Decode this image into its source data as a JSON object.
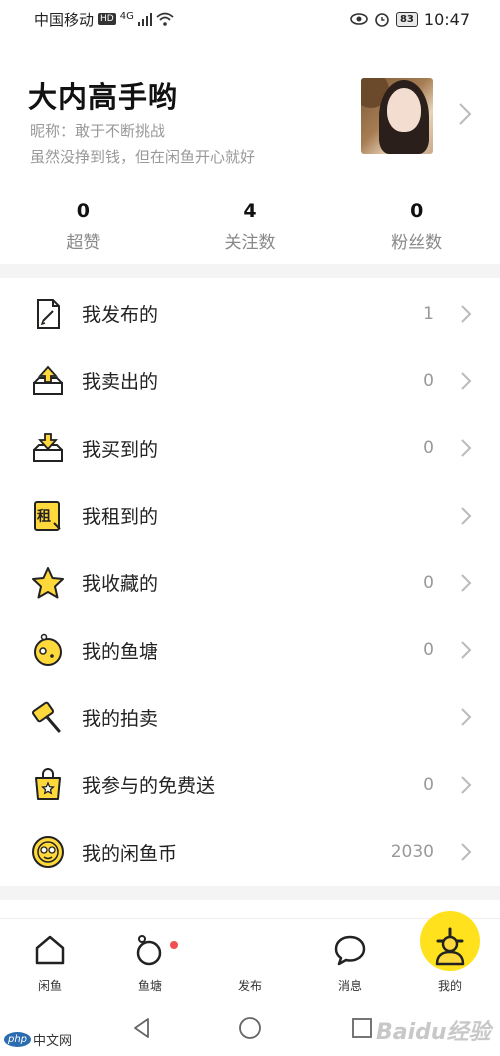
{
  "status_bar": {
    "carrier": "中国移动",
    "hd": "HD",
    "network": "4G",
    "battery": "83",
    "time": "10:47"
  },
  "profile": {
    "username": "大内高手哟",
    "nickname": "昵称：敢于不断挑战",
    "bio": "虽然没挣到钱，但在闲鱼开心就好"
  },
  "stats": [
    {
      "value": "0",
      "label": "超赞"
    },
    {
      "value": "4",
      "label": "关注数"
    },
    {
      "value": "0",
      "label": "粉丝数"
    }
  ],
  "menu": [
    {
      "label": "我发布的",
      "count": "1",
      "icon": "document-edit-icon"
    },
    {
      "label": "我卖出的",
      "count": "0",
      "icon": "box-upload-icon"
    },
    {
      "label": "我买到的",
      "count": "0",
      "icon": "box-download-icon"
    },
    {
      "label": "我租到的",
      "count": "",
      "icon": "rent-icon",
      "icon_text": "租"
    },
    {
      "label": "我收藏的",
      "count": "0",
      "icon": "star-icon"
    },
    {
      "label": "我的鱼塘",
      "count": "0",
      "icon": "fishpond-icon"
    },
    {
      "label": "我的拍卖",
      "count": "",
      "icon": "auction-hammer-icon"
    },
    {
      "label": "我参与的免费送",
      "count": "0",
      "icon": "free-gift-bag-icon"
    },
    {
      "label": "我的闲鱼币",
      "count": "2030",
      "icon": "coin-icon"
    }
  ],
  "tabbar": [
    {
      "label": "闲鱼",
      "icon": "home-icon"
    },
    {
      "label": "鱼塘",
      "icon": "fishpond-tab-icon"
    },
    {
      "label": "发布",
      "icon": "plus-icon"
    },
    {
      "label": "消息",
      "icon": "message-icon"
    },
    {
      "label": "我的",
      "icon": "profile-icon"
    }
  ],
  "colors": {
    "accent": "#ffe21d",
    "icon_yellow": "#ffd93b",
    "badge_red": "#f05050",
    "muted": "#999999"
  },
  "watermark": {
    "left_brand": "php",
    "left_text": "中文网",
    "right_text": "Baidu经验"
  }
}
